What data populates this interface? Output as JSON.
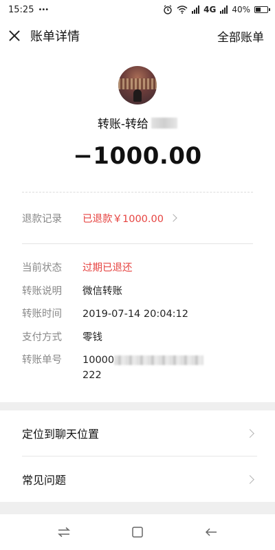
{
  "status_bar": {
    "time": "15:25",
    "dots": "•••",
    "network": "4G",
    "battery": "40%"
  },
  "nav": {
    "title": "账单详情",
    "right_action": "全部账单"
  },
  "transfer": {
    "recipient_prefix": "转账-转给",
    "amount": "−1000.00"
  },
  "refund": {
    "label": "退款记录",
    "value": "已退款￥1000.00"
  },
  "details": [
    {
      "label": "当前状态",
      "value": "过期已退还"
    },
    {
      "label": "转账说明",
      "value": "微信转账"
    },
    {
      "label": "转账时间",
      "value": "2019-07-14 20:04:12"
    },
    {
      "label": "支付方式",
      "value": "零钱"
    },
    {
      "label": "转账单号",
      "value_start": "10000",
      "value_end": "222"
    }
  ],
  "bottom_list": [
    {
      "label": "定位到聊天位置"
    },
    {
      "label": "常见问题"
    }
  ],
  "colors": {
    "accent_red": "#e64340",
    "label_gray": "#888888",
    "background": "#efefef"
  }
}
